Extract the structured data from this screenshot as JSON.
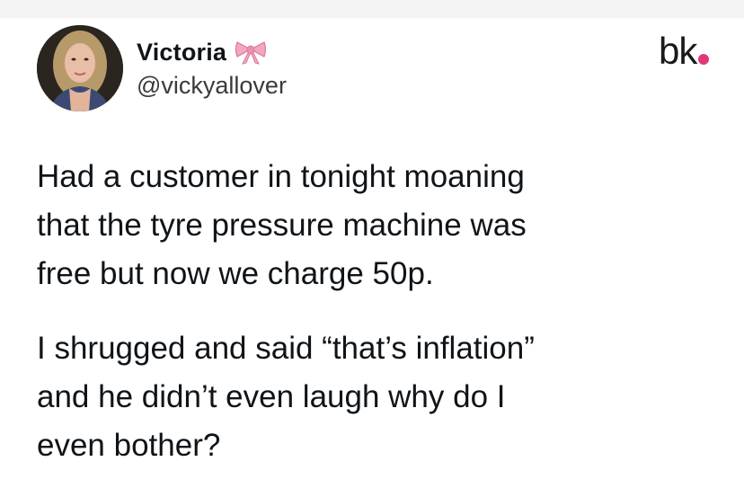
{
  "author": {
    "display_name": "Victoria",
    "handle": "@vickyallover",
    "badge_icon": "bow-emoji-icon",
    "avatar_icon": "profile-photo-icon"
  },
  "source_logo": {
    "text": "bk",
    "dot_color": "#e0397a"
  },
  "tweet": {
    "paragraph_1_lines": [
      "Had a customer in tonight moaning",
      "that the tyre pressure machine was",
      "free but now we charge 50p."
    ],
    "paragraph_2_lines": [
      "I shrugged and said “that’s inflation”",
      "and he didn’t even laugh why do I",
      "even bother?"
    ]
  },
  "colors": {
    "text": "#0f1419",
    "handle": "#3a3a3a",
    "bow": "#f4a6c0"
  }
}
